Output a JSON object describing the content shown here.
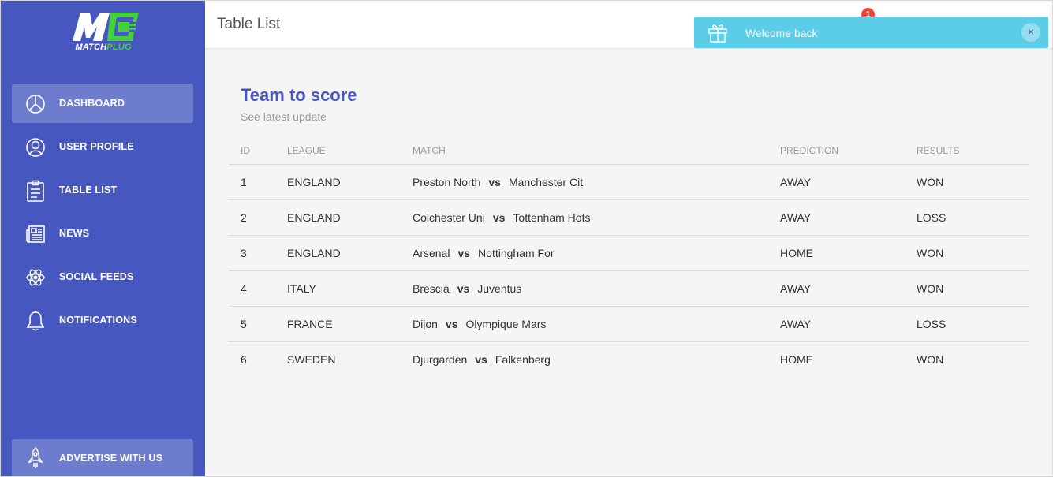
{
  "brand": {
    "logo_text_1": "MATCH",
    "logo_text_2": "PLUG",
    "logo_icon": "mp-logo-icon",
    "colors": {
      "sidebar": "#4658c0",
      "logo_green": "#44d13a",
      "accent": "#4658c0"
    }
  },
  "sidebar": {
    "items": [
      {
        "label": "DASHBOARD",
        "icon": "pie-chart-icon",
        "active": true
      },
      {
        "label": "USER PROFILE",
        "icon": "user-circle-icon",
        "active": false
      },
      {
        "label": "TABLE LIST",
        "icon": "clipboard-icon",
        "active": false
      },
      {
        "label": "NEWS",
        "icon": "newspaper-icon",
        "active": false
      },
      {
        "label": "SOCIAL FEEDS",
        "icon": "atom-icon",
        "active": false
      },
      {
        "label": "NOTIFICATIONS",
        "icon": "bell-icon",
        "active": false
      }
    ],
    "advertise": {
      "label": "ADVERTISE WITH US",
      "icon": "rocket-icon"
    }
  },
  "header": {
    "title": "Table List",
    "notification_count": "1"
  },
  "toast": {
    "message": "Welcome back",
    "icon": "gift-icon",
    "close_label": "×",
    "color": "#5bcde8"
  },
  "card": {
    "title": "Team to score",
    "subtitle": "See latest update",
    "columns": [
      "ID",
      "LEAGUE",
      "MATCH",
      "PREDICTION",
      "RESULTS"
    ],
    "vs_label": "vs",
    "rows": [
      {
        "id": "1",
        "league": "ENGLAND",
        "home": "Preston North",
        "away": "Manchester Cit",
        "prediction": "AWAY",
        "result": "WON"
      },
      {
        "id": "2",
        "league": "ENGLAND",
        "home": "Colchester Uni",
        "away": "Tottenham Hots",
        "prediction": "AWAY",
        "result": "LOSS"
      },
      {
        "id": "3",
        "league": "ENGLAND",
        "home": "Arsenal",
        "away": "Nottingham For",
        "prediction": "HOME",
        "result": "WON"
      },
      {
        "id": "4",
        "league": "ITALY",
        "home": "Brescia",
        "away": "Juventus",
        "prediction": "AWAY",
        "result": "WON"
      },
      {
        "id": "5",
        "league": "FRANCE",
        "home": "Dijon",
        "away": "Olympique Mars",
        "prediction": "AWAY",
        "result": "LOSS"
      },
      {
        "id": "6",
        "league": "SWEDEN",
        "home": "Djurgarden",
        "away": "Falkenberg",
        "prediction": "HOME",
        "result": "WON"
      }
    ]
  }
}
